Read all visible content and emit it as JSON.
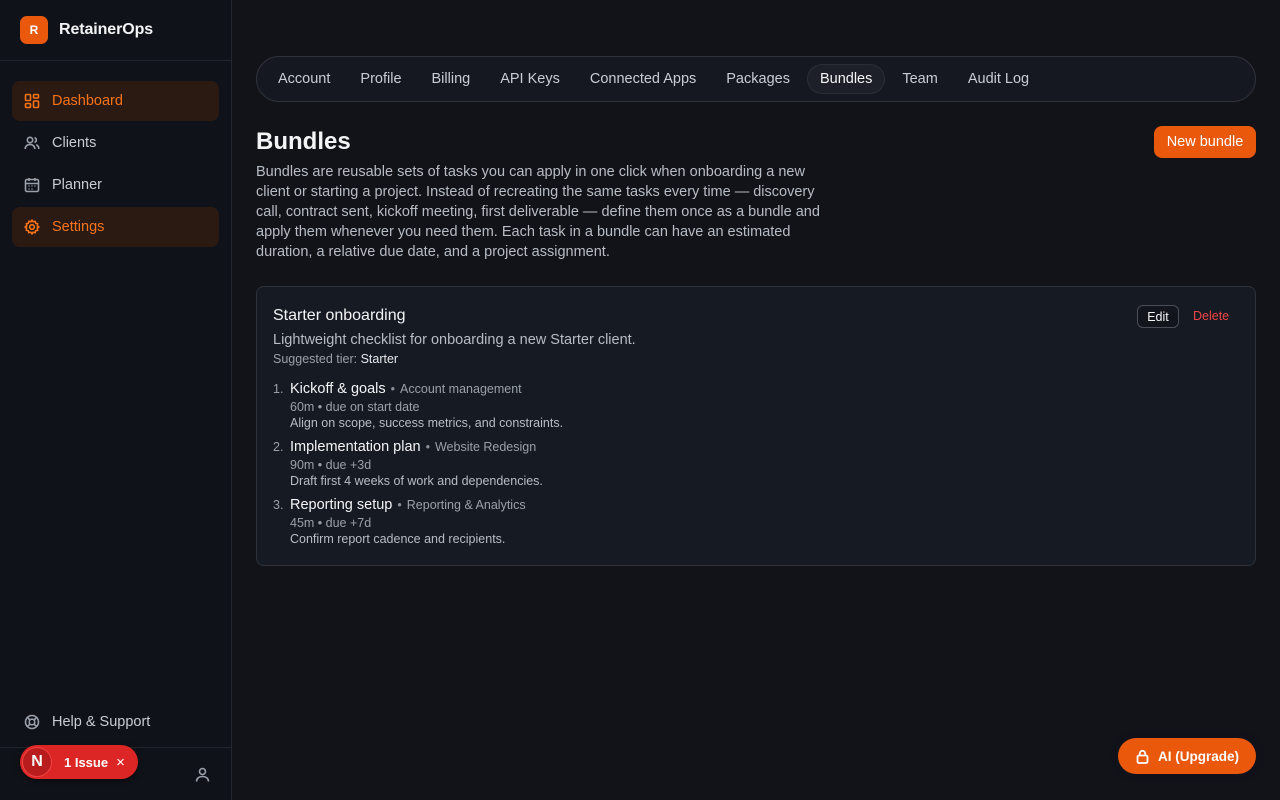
{
  "brand": {
    "logo_letter": "R",
    "name": "RetainerOps"
  },
  "sidebar": {
    "items": [
      {
        "label": "Dashboard",
        "icon": "dashboard-icon"
      },
      {
        "label": "Clients",
        "icon": "users-icon"
      },
      {
        "label": "Planner",
        "icon": "calendar-icon"
      },
      {
        "label": "Settings",
        "icon": "gear-icon"
      }
    ],
    "help_label": "Help & Support"
  },
  "issue": {
    "letter": "N",
    "label": "1 Issue",
    "close": "×"
  },
  "tabs": [
    {
      "label": "Account"
    },
    {
      "label": "Profile"
    },
    {
      "label": "Billing"
    },
    {
      "label": "API Keys"
    },
    {
      "label": "Connected Apps"
    },
    {
      "label": "Packages"
    },
    {
      "label": "Bundles",
      "active": true
    },
    {
      "label": "Team"
    },
    {
      "label": "Audit Log"
    }
  ],
  "page": {
    "title": "Bundles",
    "description": "Bundles are reusable sets of tasks you can apply in one click when onboarding a new client or starting a project. Instead of recreating the same tasks every time — discovery call, contract sent, kickoff meeting, first deliverable — define them once as a bundle and apply them whenever you need them. Each task in a bundle can have an estimated duration, a relative due date, and a project assignment.",
    "new_button": "New bundle"
  },
  "bundle": {
    "title": "Starter onboarding",
    "description": "Lightweight checklist for onboarding a new Starter client.",
    "tier_label": "Suggested tier:",
    "tier_value": "Starter",
    "edit_label": "Edit",
    "delete_label": "Delete",
    "tasks": [
      {
        "num": "1.",
        "title": "Kickoff & goals",
        "sep": "•",
        "project": "Account management",
        "meta": "60m • due on start date",
        "note": "Align on scope, success metrics, and constraints."
      },
      {
        "num": "2.",
        "title": "Implementation plan",
        "sep": "•",
        "project": "Website Redesign",
        "meta": "90m • due +3d",
        "note": "Draft first 4 weeks of work and dependencies."
      },
      {
        "num": "3.",
        "title": "Reporting setup",
        "sep": "•",
        "project": "Reporting & Analytics",
        "meta": "45m • due +7d",
        "note": "Confirm report cadence and recipients."
      }
    ]
  },
  "ai_button": {
    "label": "AI (Upgrade)",
    "icon": "lock-icon"
  },
  "colors": {
    "accent": "#ea580c",
    "accent_text": "#f97316",
    "danger": "#ef4444",
    "background": "#111319",
    "sidebar": "#0f1218"
  }
}
